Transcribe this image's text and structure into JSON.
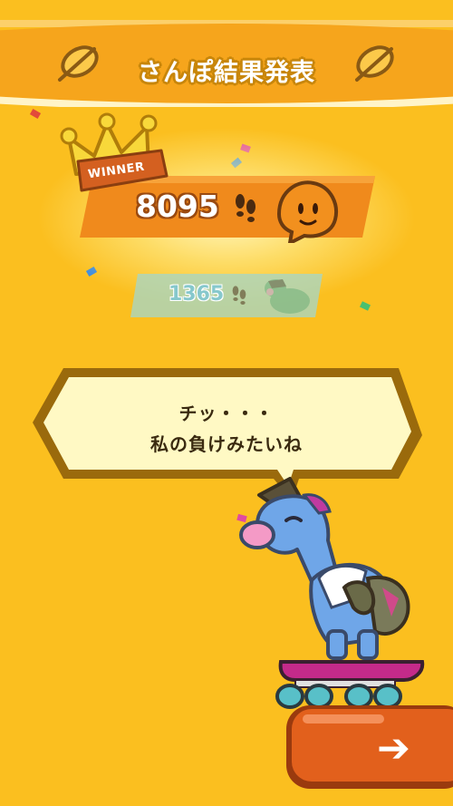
{
  "header": {
    "title": "さんぽ結果発表"
  },
  "winner": {
    "badge_label": "WINNER"
  },
  "scores": [
    {
      "steps": "8095",
      "rank": 1,
      "avatar": "orange-blob-icon"
    },
    {
      "steps": "1365",
      "rank": 2,
      "avatar": "blue-dinosaur-icon"
    }
  ],
  "dialog": {
    "line1": "チッ・・・",
    "line2": "私の負けみたいね"
  },
  "controls": {
    "next_icon": "arrow-right-icon"
  },
  "colors": {
    "background": "#fbbf1f",
    "ribbon": "#f5a81b",
    "winner_bar": "#f08a1c",
    "second_bar": "#a9d6c2",
    "bubble_fill": "#fff9c4",
    "bubble_border": "#a6770f",
    "button": "#e2601c"
  }
}
